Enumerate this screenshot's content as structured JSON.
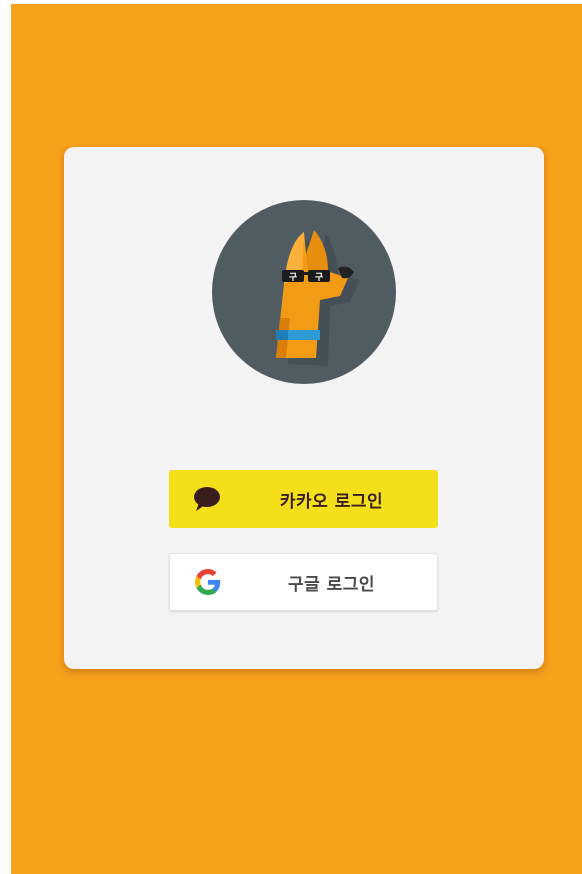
{
  "colors": {
    "background": "#f8a11b",
    "card": "#f4f4f4",
    "logo_circle": "#505c62",
    "kakao_button": "#f4e01a",
    "kakao_text": "#3a1d1d",
    "google_button": "#ffffff"
  },
  "logo": {
    "icon": "sunglasses-dog-logo",
    "glasses_text": "구구"
  },
  "buttons": {
    "kakao": {
      "label": "카카오 로그인",
      "icon": "speech-bubble-icon"
    },
    "google": {
      "label": "구글 로그인",
      "icon": "google-g-icon"
    }
  }
}
